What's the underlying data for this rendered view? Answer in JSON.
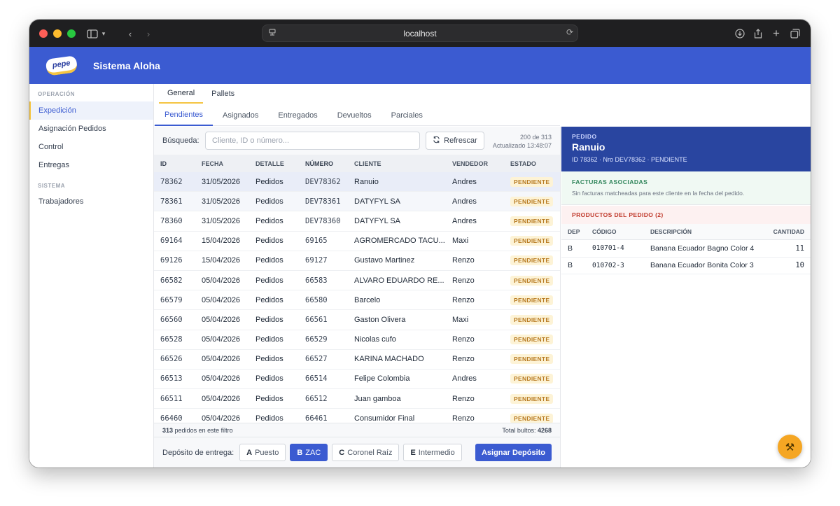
{
  "browser": {
    "url": "localhost"
  },
  "app": {
    "title": "Sistema Aloha",
    "logo_text": "pepe"
  },
  "sidebar": {
    "sections": [
      {
        "label": "OPERACIÓN",
        "items": [
          {
            "label": "Expedición",
            "active": true
          },
          {
            "label": "Asignación Pedidos"
          },
          {
            "label": "Control"
          },
          {
            "label": "Entregas"
          }
        ]
      },
      {
        "label": "SISTEMA",
        "items": [
          {
            "label": "Trabajadores"
          }
        ]
      }
    ]
  },
  "tabs_top": [
    "General",
    "Pallets"
  ],
  "tabs_sub": [
    "Pendientes",
    "Asignados",
    "Entregados",
    "Devueltos",
    "Parciales"
  ],
  "search": {
    "label": "Búsqueda:",
    "placeholder": "Cliente, ID o número...",
    "refresh_label": "Refrescar",
    "count": "200 de 313",
    "updated": "Actualizado 13:48:07"
  },
  "table": {
    "headers": [
      "ID",
      "FECHA",
      "DETALLE",
      "NÚMERO",
      "CLIENTE",
      "VENDEDOR",
      "ESTADO"
    ],
    "rows": [
      [
        "78362",
        "31/05/2026",
        "Pedidos",
        "DEV78362",
        "Ranuio",
        "Andres",
        "PENDIENTE"
      ],
      [
        "78361",
        "31/05/2026",
        "Pedidos",
        "DEV78361",
        "DATYFYL SA",
        "Andres",
        "PENDIENTE"
      ],
      [
        "78360",
        "31/05/2026",
        "Pedidos",
        "DEV78360",
        "DATYFYL SA",
        "Andres",
        "PENDIENTE"
      ],
      [
        "69164",
        "15/04/2026",
        "Pedidos",
        "69165",
        "AGROMERCADO TACU...",
        "Maxi",
        "PENDIENTE"
      ],
      [
        "69126",
        "15/04/2026",
        "Pedidos",
        "69127",
        "Gustavo Martinez",
        "Renzo",
        "PENDIENTE"
      ],
      [
        "66582",
        "05/04/2026",
        "Pedidos",
        "66583",
        "ALVARO EDUARDO RE...",
        "Renzo",
        "PENDIENTE"
      ],
      [
        "66579",
        "05/04/2026",
        "Pedidos",
        "66580",
        "Barcelo",
        "Renzo",
        "PENDIENTE"
      ],
      [
        "66560",
        "05/04/2026",
        "Pedidos",
        "66561",
        "Gaston Olivera",
        "Maxi",
        "PENDIENTE"
      ],
      [
        "66528",
        "05/04/2026",
        "Pedidos",
        "66529",
        "Nicolas cufo",
        "Renzo",
        "PENDIENTE"
      ],
      [
        "66526",
        "05/04/2026",
        "Pedidos",
        "66527",
        "KARINA MACHADO",
        "Renzo",
        "PENDIENTE"
      ],
      [
        "66513",
        "05/04/2026",
        "Pedidos",
        "66514",
        "Felipe Colombia",
        "Andres",
        "PENDIENTE"
      ],
      [
        "66511",
        "05/04/2026",
        "Pedidos",
        "66512",
        "Juan gamboa",
        "Renzo",
        "PENDIENTE"
      ],
      [
        "66460",
        "05/04/2026",
        "Pedidos",
        "66461",
        "Consumidor Final",
        "Renzo",
        "PENDIENTE"
      ]
    ],
    "footer_count": "313",
    "footer_text": "pedidos en este filtro",
    "total_label": "Total bultos:",
    "total_value": "4268"
  },
  "deposit": {
    "label": "Depósito de entrega:",
    "options": [
      {
        "key": "A",
        "label": "Puesto"
      },
      {
        "key": "B",
        "label": "ZAC",
        "active": true
      },
      {
        "key": "C",
        "label": "Coronel Raíz"
      },
      {
        "key": "E",
        "label": "Intermedio"
      }
    ],
    "assign_label": "Asignar Depósito"
  },
  "detail": {
    "label": "PEDIDO",
    "name": "Ranuio",
    "subtitle": "ID 78362 · Nro DEV78362 · PENDIENTE",
    "facturas_title": "FACTURAS ASOCIADAS",
    "facturas_text": "Sin facturas matcheadas para este cliente en la fecha del pedido.",
    "productos_title": "PRODUCTOS DEL PEDIDO (2)",
    "product_headers": [
      "DEP",
      "CÓDIGO",
      "DESCRIPCIÓN",
      "CANTIDAD"
    ],
    "products": [
      [
        "B",
        "010701-4",
        "Banana Ecuador Bagno Color 4",
        "11"
      ],
      [
        "B",
        "010702-3",
        "Banana Ecuador Bonita Color 3",
        "10"
      ]
    ]
  },
  "colors": {
    "brand": "#3b5bd1",
    "accent": "#f5c542",
    "badge_bg": "#fdf3d6",
    "badge_text": "#b7791f"
  }
}
